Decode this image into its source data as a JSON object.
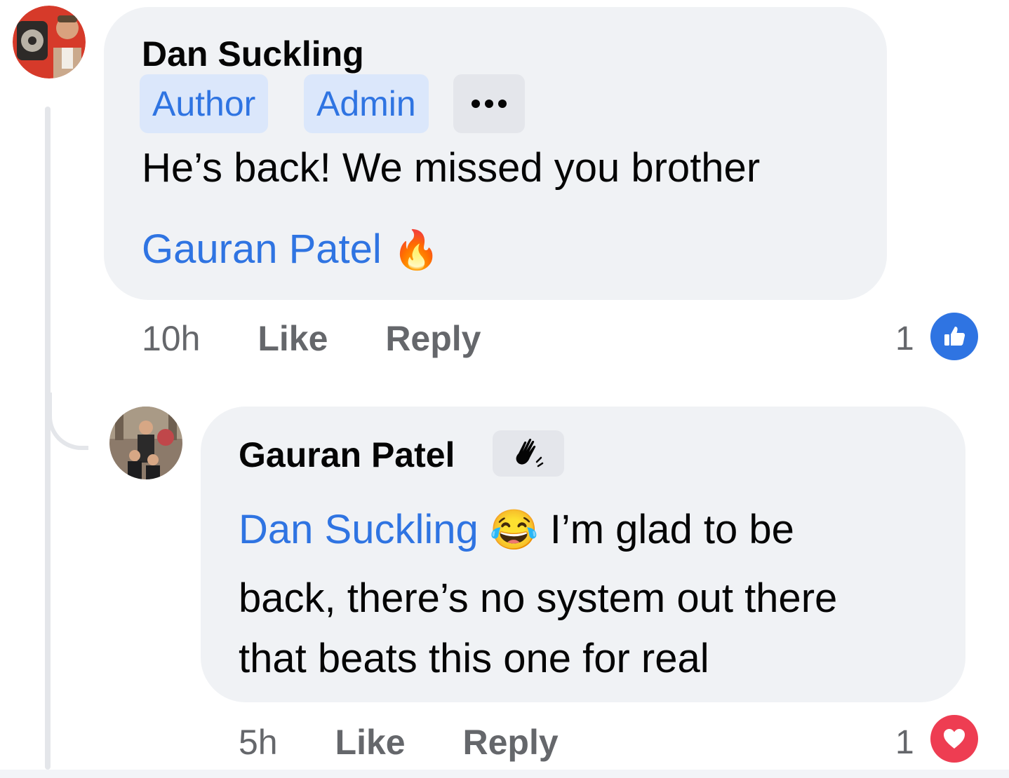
{
  "comment": {
    "author": "Dan Suckling",
    "badges": [
      "Author",
      "Admin"
    ],
    "text": "He’s back! We missed you brother",
    "mention": "Gauran Patel",
    "emoji": "🔥",
    "time": "10h",
    "like_label": "Like",
    "reply_label": "Reply",
    "reaction_count": "1",
    "reaction_icon": "like-icon",
    "reaction_color": "#2f74e2"
  },
  "reply": {
    "author": "Gauran Patel",
    "author_badge_icon": "wave-icon",
    "mention": "Dan Suckling",
    "emoji": "😂",
    "line1_rest": "I’m glad to be",
    "line2": "back, there’s no system out there",
    "line3": "that beats this one for real",
    "time": "5h",
    "like_label": "Like",
    "reply_label": "Reply",
    "reaction_count": "1",
    "reaction_icon": "heart-icon",
    "reaction_color": "#ee3d52"
  }
}
